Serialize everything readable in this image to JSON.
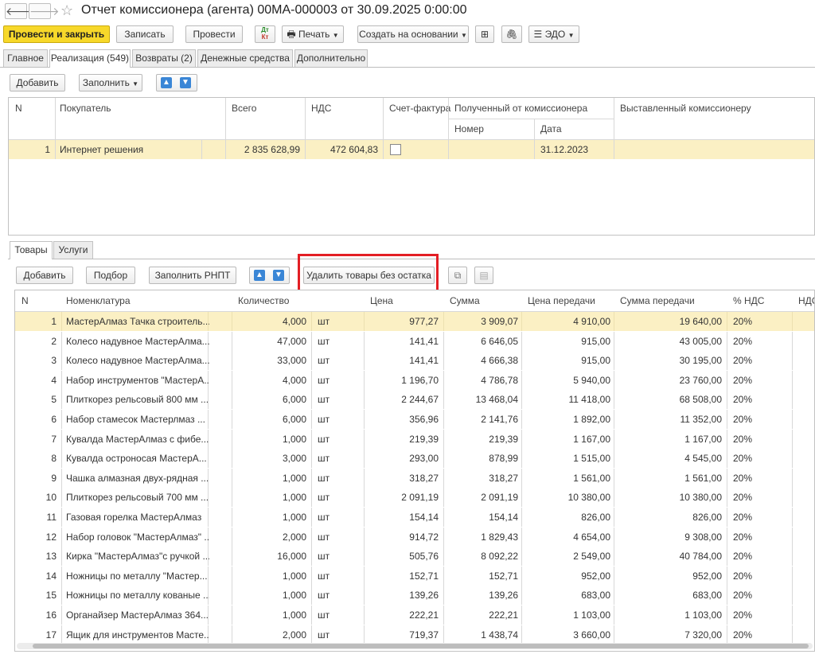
{
  "window": {
    "title": "Отчет комиссионера (агента) 00МА-000003 от 30.09.2025 0:00:00"
  },
  "toolbar": {
    "post_close": "Провести и закрыть",
    "write": "Записать",
    "post": "Провести",
    "print": "Печать",
    "create_basis": "Создать на основании",
    "edo": "ЭДО"
  },
  "tabs": [
    "Главное",
    "Реализация (549)",
    "Возвраты (2)",
    "Денежные средства",
    "Дополнительно"
  ],
  "sales": {
    "add": "Добавить",
    "fill": "Заполнить",
    "headers": {
      "n": "N",
      "buyer": "Покупатель",
      "total": "Всего",
      "vat": "НДС",
      "invoice": "Счет-фактура",
      "received": "Полученный от комиссионера",
      "number": "Номер",
      "date": "Дата",
      "issued": "Выставленный комиссионеру"
    },
    "row": {
      "n": "1",
      "buyer": "Интернет решения",
      "total": "2 835 628,99",
      "vat": "472 604,83",
      "date": "31.12.2023"
    }
  },
  "subtabs": [
    "Товары",
    "Услуги"
  ],
  "goods": {
    "add": "Добавить",
    "pick": "Подбор",
    "fill_rnpt": "Заполнить РНПТ",
    "delete_no_rest": "Удалить товары без остатка",
    "headers": {
      "n": "N",
      "name": "Номенклатура",
      "qty": "Количество",
      "price": "Цена",
      "sum": "Сумма",
      "transfer_price": "Цена передачи",
      "transfer_sum": "Сумма передачи",
      "vat_rate": "% НДС",
      "vat": "НДС"
    },
    "rows": [
      {
        "n": "1",
        "name": "МастерАлмаз Тачка строитель...",
        "qty": "4,000",
        "unit": "шт",
        "price": "977,27",
        "sum": "3 909,07",
        "tprice": "4 910,00",
        "tsum": "19 640,00",
        "rate": "20%"
      },
      {
        "n": "2",
        "name": "Колесо надувное МастерАлма...",
        "qty": "47,000",
        "unit": "шт",
        "price": "141,41",
        "sum": "6 646,05",
        "tprice": "915,00",
        "tsum": "43 005,00",
        "rate": "20%"
      },
      {
        "n": "3",
        "name": "Колесо надувное МастерАлма...",
        "qty": "33,000",
        "unit": "шт",
        "price": "141,41",
        "sum": "4 666,38",
        "tprice": "915,00",
        "tsum": "30 195,00",
        "rate": "20%"
      },
      {
        "n": "4",
        "name": "Набор инструментов \"МастерА...",
        "qty": "4,000",
        "unit": "шт",
        "price": "1 196,70",
        "sum": "4 786,78",
        "tprice": "5 940,00",
        "tsum": "23 760,00",
        "rate": "20%"
      },
      {
        "n": "5",
        "name": "Плиткорез рельсовый 800 мм ...",
        "qty": "6,000",
        "unit": "шт",
        "price": "2 244,67",
        "sum": "13 468,04",
        "tprice": "11 418,00",
        "tsum": "68 508,00",
        "rate": "20%"
      },
      {
        "n": "6",
        "name": "Набор стамесок Мастерлмаз ...",
        "qty": "6,000",
        "unit": "шт",
        "price": "356,96",
        "sum": "2 141,76",
        "tprice": "1 892,00",
        "tsum": "11 352,00",
        "rate": "20%"
      },
      {
        "n": "7",
        "name": "Кувалда  МастерАлмаз с фибе...",
        "qty": "1,000",
        "unit": "шт",
        "price": "219,39",
        "sum": "219,39",
        "tprice": "1 167,00",
        "tsum": "1 167,00",
        "rate": "20%"
      },
      {
        "n": "8",
        "name": "Кувалда остроносая  МастерА...",
        "qty": "3,000",
        "unit": "шт",
        "price": "293,00",
        "sum": "878,99",
        "tprice": "1 515,00",
        "tsum": "4 545,00",
        "rate": "20%"
      },
      {
        "n": "9",
        "name": "Чашка алмазная двух-рядная ...",
        "qty": "1,000",
        "unit": "шт",
        "price": "318,27",
        "sum": "318,27",
        "tprice": "1 561,00",
        "tsum": "1 561,00",
        "rate": "20%"
      },
      {
        "n": "10",
        "name": "Плиткорез рельсовый 700 мм ...",
        "qty": "1,000",
        "unit": "шт",
        "price": "2 091,19",
        "sum": "2 091,19",
        "tprice": "10 380,00",
        "tsum": "10 380,00",
        "rate": "20%"
      },
      {
        "n": "11",
        "name": "Газовая горелка МастерАлмаз",
        "qty": "1,000",
        "unit": "шт",
        "price": "154,14",
        "sum": "154,14",
        "tprice": "826,00",
        "tsum": "826,00",
        "rate": "20%"
      },
      {
        "n": "12",
        "name": "Набор головок \"МастерАлмаз\" ...",
        "qty": "2,000",
        "unit": "шт",
        "price": "914,72",
        "sum": "1 829,43",
        "tprice": "4 654,00",
        "tsum": "9 308,00",
        "rate": "20%"
      },
      {
        "n": "13",
        "name": "Кирка \"МастерАлмаз\"с ручкой ...",
        "qty": "16,000",
        "unit": "шт",
        "price": "505,76",
        "sum": "8 092,22",
        "tprice": "2 549,00",
        "tsum": "40 784,00",
        "rate": "20%"
      },
      {
        "n": "14",
        "name": "Ножницы по металлу \"Мастер...",
        "qty": "1,000",
        "unit": "шт",
        "price": "152,71",
        "sum": "152,71",
        "tprice": "952,00",
        "tsum": "952,00",
        "rate": "20%"
      },
      {
        "n": "15",
        "name": "Ножницы по металлу кованые ...",
        "qty": "1,000",
        "unit": "шт",
        "price": "139,26",
        "sum": "139,26",
        "tprice": "683,00",
        "tsum": "683,00",
        "rate": "20%"
      },
      {
        "n": "16",
        "name": "Органайзер МастерАлмаз 364...",
        "qty": "1,000",
        "unit": "шт",
        "price": "222,21",
        "sum": "222,21",
        "tprice": "1 103,00",
        "tsum": "1 103,00",
        "rate": "20%"
      },
      {
        "n": "17",
        "name": "Ящик для инструментов Масте...",
        "qty": "2,000",
        "unit": "шт",
        "price": "719,37",
        "sum": "1 438,74",
        "tprice": "3 660,00",
        "tsum": "7 320,00",
        "rate": "20%"
      }
    ]
  },
  "colors": {
    "accent": "#f7d82a",
    "selected_row": "#fbf0c4",
    "highlight_box": "#e31e24",
    "arrow": "#3a86d6"
  }
}
